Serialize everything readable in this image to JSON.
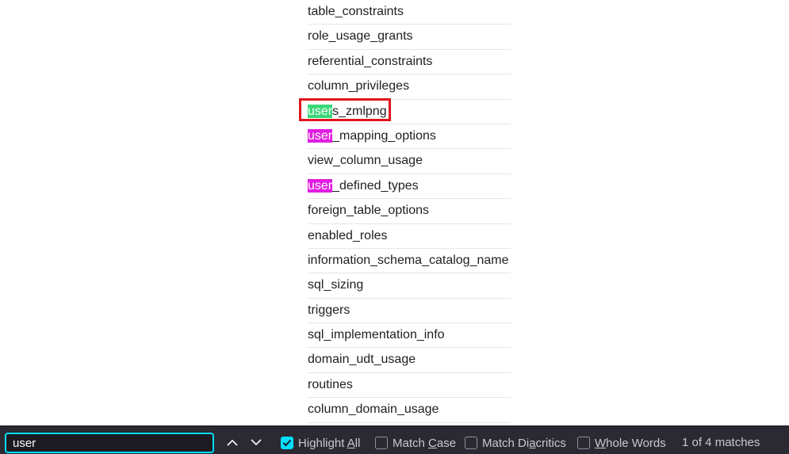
{
  "table_list": [
    {
      "pre": "",
      "highlight": "",
      "post": "table_constraints",
      "kind": "none"
    },
    {
      "pre": "",
      "highlight": "",
      "post": "role_usage_grants",
      "kind": "none"
    },
    {
      "pre": "",
      "highlight": "",
      "post": "referential_constraints",
      "kind": "none"
    },
    {
      "pre": "",
      "highlight": "",
      "post": "column_privileges",
      "kind": "none"
    },
    {
      "pre": "",
      "highlight": "user",
      "post": "s_zmlpng",
      "kind": "current"
    },
    {
      "pre": "",
      "highlight": "user",
      "post": "_mapping_options",
      "kind": "match"
    },
    {
      "pre": "",
      "highlight": "",
      "post": "view_column_usage",
      "kind": "none"
    },
    {
      "pre": "",
      "highlight": "user",
      "post": "_defined_types",
      "kind": "match"
    },
    {
      "pre": "",
      "highlight": "",
      "post": "foreign_table_options",
      "kind": "none"
    },
    {
      "pre": "",
      "highlight": "",
      "post": "enabled_roles",
      "kind": "none"
    },
    {
      "pre": "",
      "highlight": "",
      "post": "information_schema_catalog_name",
      "kind": "none"
    },
    {
      "pre": "",
      "highlight": "",
      "post": "sql_sizing",
      "kind": "none"
    },
    {
      "pre": "",
      "highlight": "",
      "post": "triggers",
      "kind": "none"
    },
    {
      "pre": "",
      "highlight": "",
      "post": "sql_implementation_info",
      "kind": "none"
    },
    {
      "pre": "",
      "highlight": "",
      "post": "domain_udt_usage",
      "kind": "none"
    },
    {
      "pre": "",
      "highlight": "",
      "post": "routines",
      "kind": "none"
    },
    {
      "pre": "",
      "highlight": "",
      "post": "column_domain_usage",
      "kind": "none"
    }
  ],
  "findbar": {
    "search_value": "user",
    "prev_icon": "chevron-up-icon",
    "next_icon": "chevron-down-icon",
    "highlight_all": {
      "before": "Highlight ",
      "mnemonic": "A",
      "after": "ll",
      "checked": true
    },
    "match_case": {
      "before": "Match ",
      "mnemonic": "C",
      "after": "ase",
      "checked": false
    },
    "match_diacritics": {
      "before": "Match Di",
      "mnemonic": "a",
      "after": "critics",
      "checked": false
    },
    "whole_words": {
      "before": "",
      "mnemonic": "W",
      "after": "hole Words",
      "checked": false
    },
    "match_count": "1 of 4 matches"
  },
  "colors": {
    "match_highlight": "#e11ee1",
    "current_match_highlight": "#38d878",
    "current_box": "#e0141e",
    "findbar_bg": "#2b2a33",
    "accent": "#00ddff"
  }
}
